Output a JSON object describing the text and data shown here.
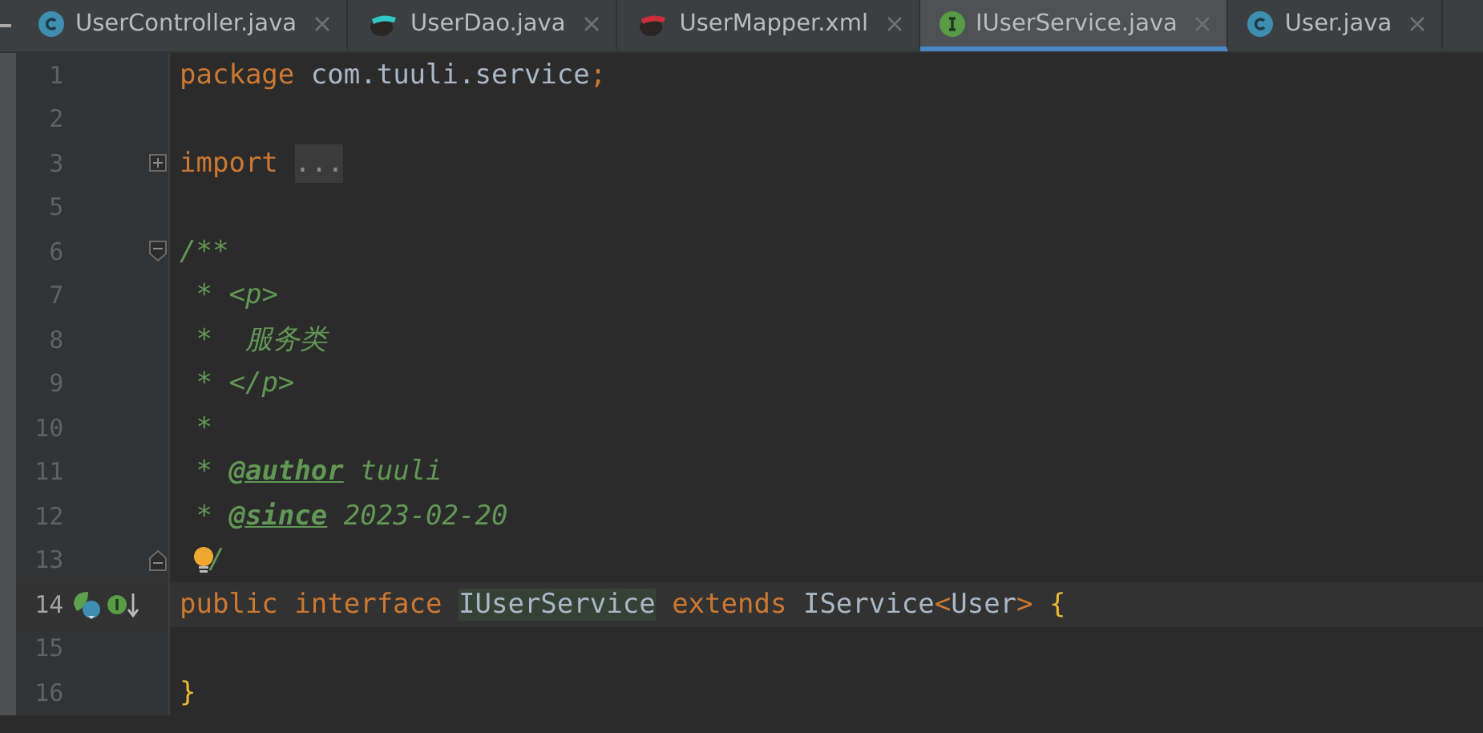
{
  "tabs": [
    {
      "label": "UserController.java",
      "kind": "class",
      "selected": false
    },
    {
      "label": "UserDao.java",
      "kind": "dao",
      "selected": false
    },
    {
      "label": "UserMapper.xml",
      "kind": "mapper",
      "selected": false
    },
    {
      "label": "IUserService.java",
      "kind": "interface",
      "selected": true
    },
    {
      "label": "User.java",
      "kind": "class",
      "selected": false
    }
  ],
  "lines": [
    {
      "number": "1",
      "kind": "code",
      "current": false,
      "tokens": [
        {
          "kind": "keyword",
          "text": "package "
        },
        {
          "kind": "plain",
          "text": "com.tuuli.service"
        },
        {
          "kind": "keyword",
          "text": ";"
        }
      ]
    },
    {
      "number": "2",
      "kind": "code",
      "current": false
    },
    {
      "number": "3",
      "kind": "folded",
      "current": false,
      "tokens": [
        {
          "kind": "keyword",
          "text": "import "
        },
        {
          "kind": "folded",
          "text": "..."
        }
      ]
    },
    {
      "number": "5",
      "kind": "code",
      "current": false
    },
    {
      "number": "6",
      "kind": "docstart",
      "current": false,
      "tokens": [
        {
          "kind": "doc",
          "text": "/**"
        }
      ]
    },
    {
      "number": "7",
      "kind": "code",
      "current": false,
      "tokens": [
        {
          "kind": "doc",
          "text": " * "
        },
        {
          "kind": "doc",
          "text": "<p>"
        }
      ]
    },
    {
      "number": "8",
      "kind": "code",
      "current": false,
      "tokens": [
        {
          "kind": "doc",
          "text": " *  服务类"
        }
      ]
    },
    {
      "number": "9",
      "kind": "code",
      "current": false,
      "tokens": [
        {
          "kind": "doc",
          "text": " * "
        },
        {
          "kind": "doc",
          "text": "</p>"
        }
      ]
    },
    {
      "number": "10",
      "kind": "code",
      "current": false,
      "tokens": [
        {
          "kind": "doc",
          "text": " *"
        }
      ]
    },
    {
      "number": "11",
      "kind": "code",
      "current": false,
      "tokens": [
        {
          "kind": "doc",
          "text": " * "
        },
        {
          "kind": "doctag",
          "text": "@author"
        },
        {
          "kind": "doc",
          "text": " tuuli"
        }
      ]
    },
    {
      "number": "12",
      "kind": "code",
      "current": false,
      "tokens": [
        {
          "kind": "doc",
          "text": " * "
        },
        {
          "kind": "doctag",
          "text": "@since"
        },
        {
          "kind": "doc",
          "text": " 2023-02-20"
        }
      ]
    },
    {
      "number": "13",
      "kind": "docend",
      "current": false,
      "tokens": [
        {
          "kind": "doc",
          "text": "/"
        }
      ]
    },
    {
      "number": "14",
      "kind": "declaration",
      "current": true,
      "tokens": [
        {
          "kind": "keyword",
          "text": "public interface "
        },
        {
          "kind": "highlight",
          "text": "IUserService"
        },
        {
          "kind": "keyword",
          "text": " extends "
        },
        {
          "kind": "plain",
          "text": "IService"
        },
        {
          "kind": "keyword",
          "text": "<"
        },
        {
          "kind": "plain",
          "text": "User"
        },
        {
          "kind": "keyword",
          "text": "> "
        },
        {
          "kind": "brace",
          "text": "{"
        }
      ]
    },
    {
      "number": "15",
      "kind": "code",
      "current": false
    },
    {
      "number": "16",
      "kind": "code",
      "current": false,
      "tokens": [
        {
          "kind": "brace",
          "text": "}"
        }
      ]
    }
  ]
}
